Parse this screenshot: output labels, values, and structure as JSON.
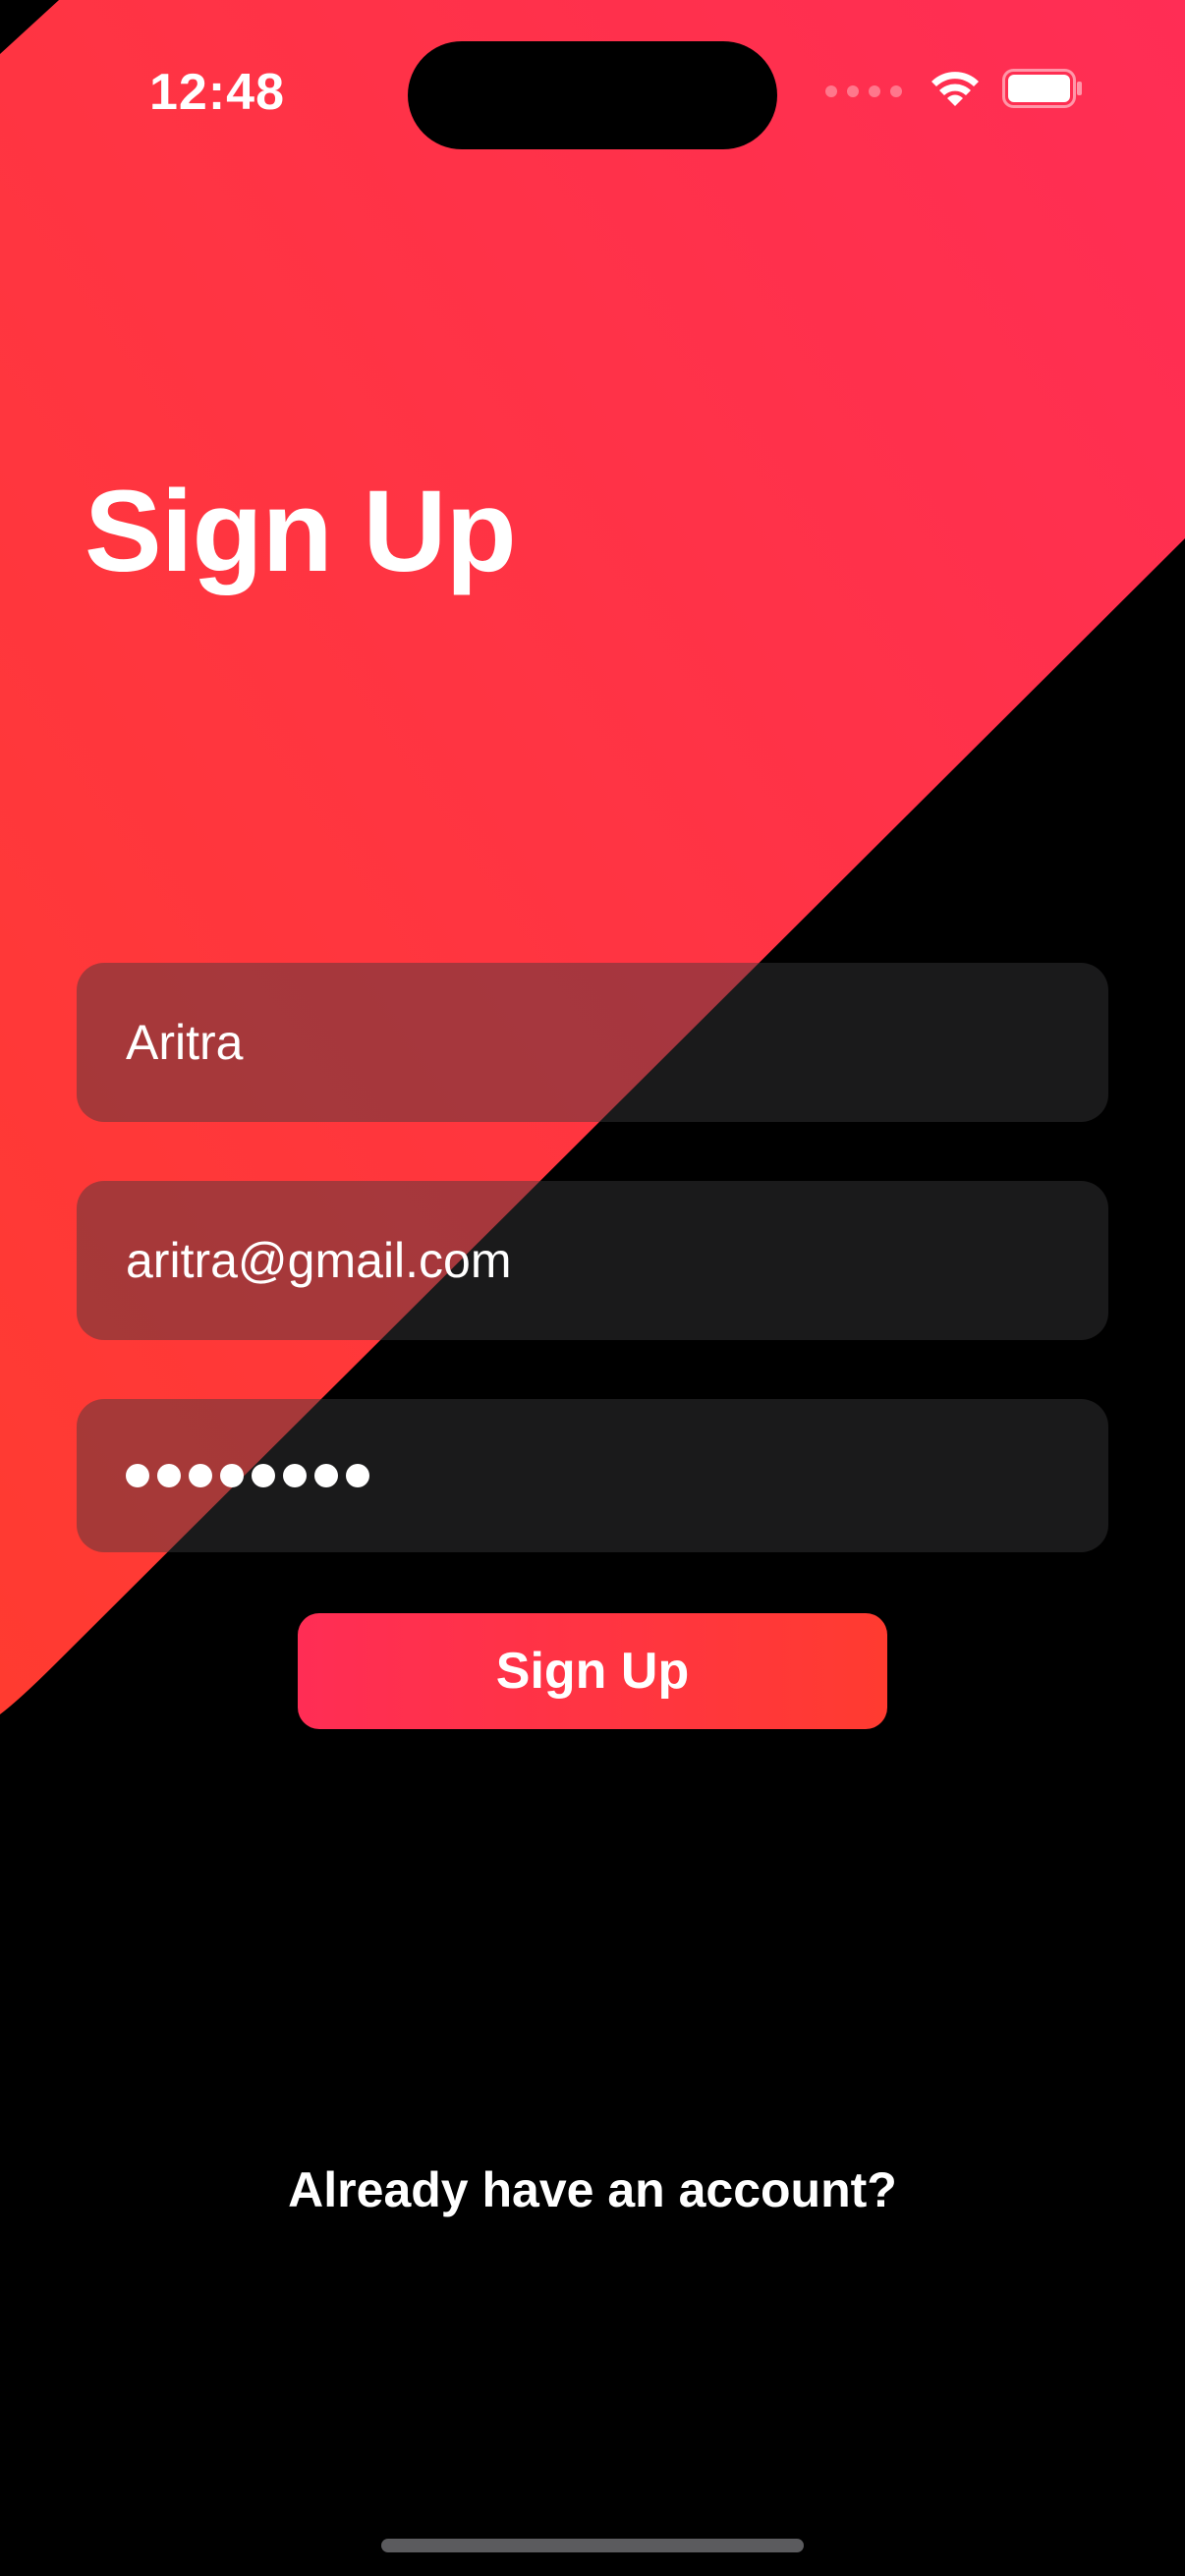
{
  "status_bar": {
    "time": "12:48"
  },
  "header": {
    "title": "Sign Up"
  },
  "form": {
    "name_value": "Aritra",
    "email_value": "aritra@gmail.com",
    "password_mask_count": 8
  },
  "actions": {
    "signup_label": "Sign Up",
    "login_prompt": "Already have an account?"
  },
  "colors": {
    "accent_start": "#ff2d55",
    "accent_end": "#ff3b30",
    "background": "#000000",
    "field_fill": "#3a3a3c"
  },
  "icons": [
    "signal-icon",
    "wifi-icon",
    "battery-icon"
  ]
}
